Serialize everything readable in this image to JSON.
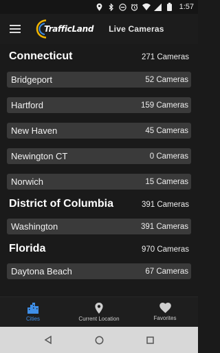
{
  "status_bar": {
    "time": "1:57"
  },
  "header": {
    "logo_text": "TrafficLand",
    "title": "Live Cameras"
  },
  "sections": [
    {
      "name": "Connecticut",
      "count": "271 Cameras",
      "cities": [
        {
          "name": "Bridgeport",
          "count": "52 Cameras"
        },
        {
          "name": "Hartford",
          "count": "159 Cameras"
        },
        {
          "name": "New Haven",
          "count": "45 Cameras"
        },
        {
          "name": "Newington CT",
          "count": "0 Cameras"
        },
        {
          "name": "Norwich",
          "count": "15 Cameras"
        }
      ]
    },
    {
      "name": "District of Columbia",
      "count": "391 Cameras",
      "cities": [
        {
          "name": "Washington",
          "count": "391 Cameras"
        }
      ]
    },
    {
      "name": "Florida",
      "count": "970 Cameras",
      "cities": [
        {
          "name": "Daytona Beach",
          "count": "67 Cameras"
        }
      ]
    }
  ],
  "bottom_nav": [
    {
      "label": "Cities",
      "icon": "city-icon",
      "active": true
    },
    {
      "label": "Current Location",
      "icon": "location-pin-icon",
      "active": false
    },
    {
      "label": "Favorites",
      "icon": "heart-icon",
      "active": false
    }
  ],
  "colors": {
    "active": "#3f8fe8",
    "row": "#3a3a3a",
    "background": "#1a1a1a",
    "logo_ring": "#f0b400"
  }
}
